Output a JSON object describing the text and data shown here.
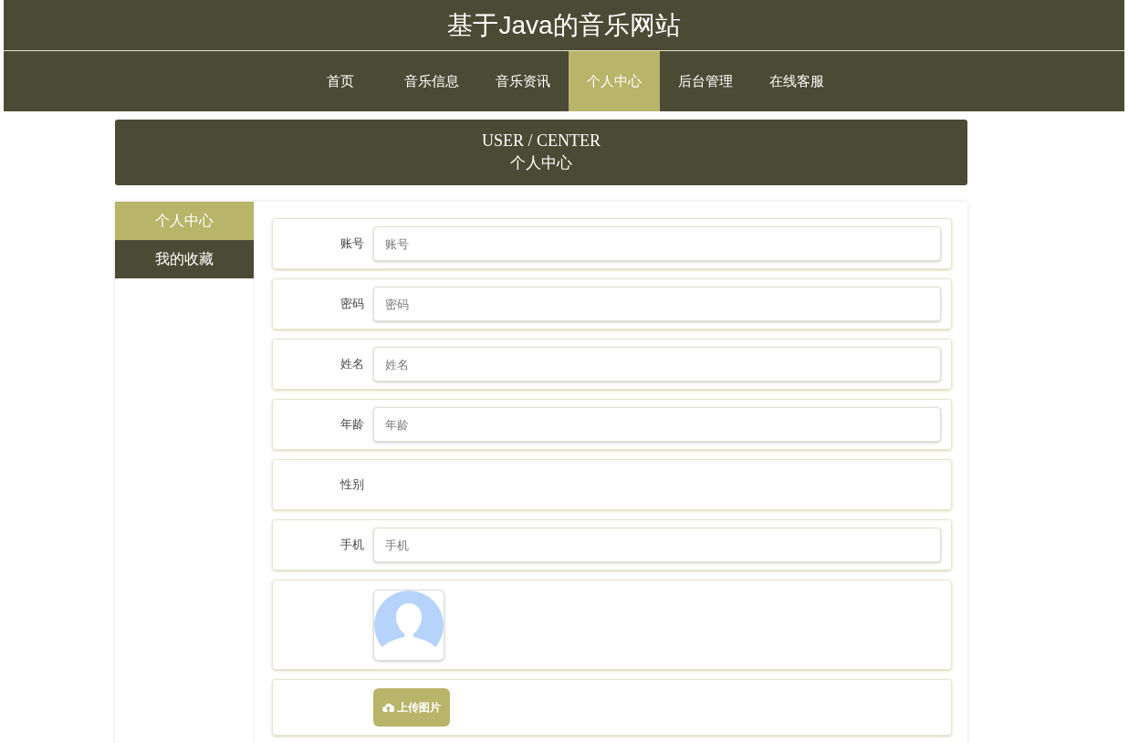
{
  "site_title": "基于Java的音乐网站",
  "nav": [
    {
      "label": "首页",
      "selected": false
    },
    {
      "label": "音乐信息",
      "selected": false
    },
    {
      "label": "音乐资讯",
      "selected": false
    },
    {
      "label": "个人中心",
      "selected": true
    },
    {
      "label": "后台管理",
      "selected": false
    },
    {
      "label": "在线客服",
      "selected": false
    }
  ],
  "banner": {
    "title": "USER / CENTER",
    "subtitle": "个人中心"
  },
  "sidebar": [
    {
      "label": "个人中心",
      "selected": true
    },
    {
      "label": "我的收藏",
      "selected": false
    }
  ],
  "form": [
    {
      "kind": "input",
      "label": "账号",
      "placeholder": "账号"
    },
    {
      "kind": "input",
      "label": "密码",
      "placeholder": "密码"
    },
    {
      "kind": "input",
      "label": "姓名",
      "placeholder": "姓名"
    },
    {
      "kind": "input",
      "label": "年龄",
      "placeholder": "年龄"
    },
    {
      "kind": "empty",
      "label": "性别"
    },
    {
      "kind": "input",
      "label": "手机",
      "placeholder": "手机"
    },
    {
      "kind": "avatar"
    },
    {
      "kind": "upload",
      "button": "上传图片"
    }
  ]
}
